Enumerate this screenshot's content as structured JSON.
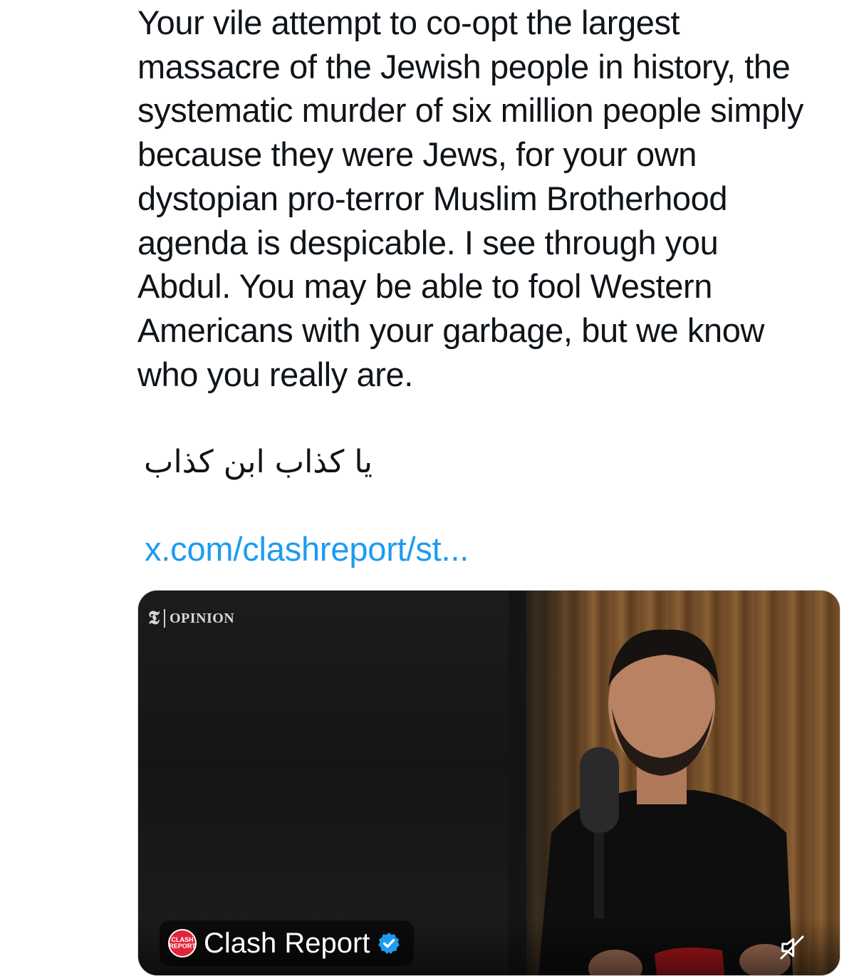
{
  "tweet": {
    "text": "Your vile attempt to co-opt the largest\nmassacre of the Jewish people in history, the\nsystematic murder of six million people simply\nbecause they were Jews, for your own\ndystopian pro-terror Muslim Brotherhood\nagenda is despicable. I see through you\nAbdul. You may be able to fool Western\nAmericans with your garbage, but we know\nwho you really are.",
    "arabic_text": "يا كذاب ابن كذاب",
    "link_text": "x.com/clashreport/st..."
  },
  "media": {
    "overlay_logo": "𝕿",
    "overlay_label": "OPINION",
    "source_avatar_text": "CLASH REPORT",
    "source_name": "Clash Report",
    "verified_icon": "verified-badge-icon",
    "mute_icon": "speaker-muted-icon"
  },
  "colors": {
    "link": "#1d9bf0",
    "verified": "#1d9bf0",
    "avatar": "#e0243a"
  }
}
